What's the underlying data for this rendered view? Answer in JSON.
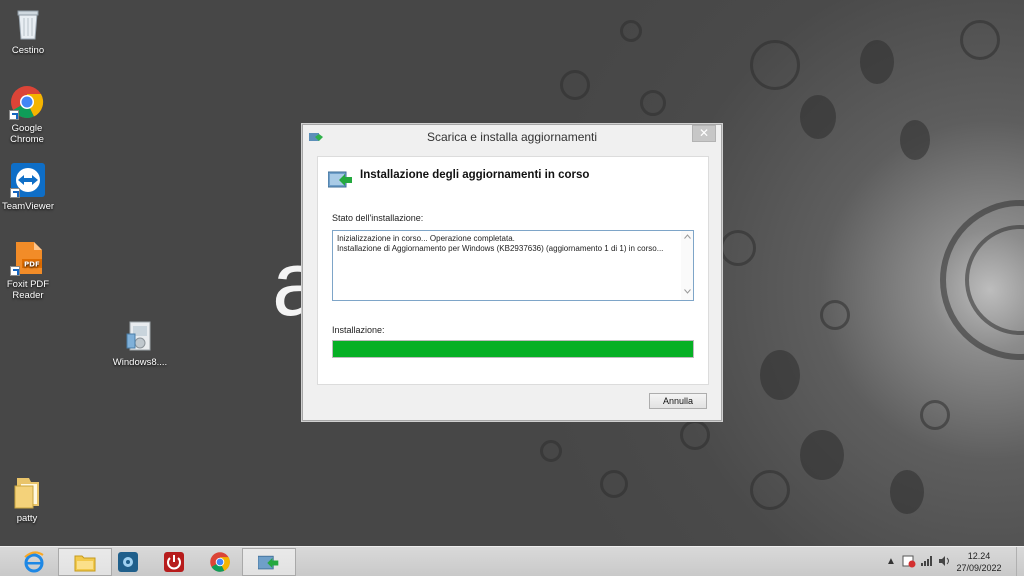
{
  "desktop": {
    "wallpaper_letter": "a",
    "icons": [
      {
        "label": "Cestino",
        "icon": "recycle-bin-icon"
      },
      {
        "label": "Google Chrome",
        "icon": "chrome-icon"
      },
      {
        "label": "TeamViewer",
        "icon": "teamviewer-icon"
      },
      {
        "label": "Foxit PDF Reader",
        "icon": "foxit-pdf-icon"
      },
      {
        "label": "Windows8....",
        "icon": "installer-icon"
      },
      {
        "label": "patty",
        "icon": "folder-icon"
      }
    ]
  },
  "dialog": {
    "title": "Scarica e installa aggiornamenti",
    "close_label": "✕",
    "header": "Installazione degli aggiornamenti in corso",
    "status_label": "Stato dell'installazione:",
    "status_lines": [
      "Inizializzazione in corso... Operazione completata.",
      "Installazione di Aggiornamento per Windows (KB2937636) (aggiornamento 1 di 1) in corso..."
    ],
    "progress_label": "Installazione:",
    "progress_percent": 100,
    "progress_color": "#06b025",
    "cancel_label": "Annulla"
  },
  "taskbar": {
    "buttons": [
      {
        "icon": "internet-explorer-icon"
      },
      {
        "icon": "file-explorer-icon"
      },
      {
        "icon": "control-panel-icon"
      },
      {
        "icon": "shutdown-icon"
      },
      {
        "icon": "chrome-icon"
      },
      {
        "icon": "windows-update-icon",
        "active": true
      }
    ],
    "tray": {
      "time": "12.24",
      "date": "27/09/2022"
    }
  }
}
